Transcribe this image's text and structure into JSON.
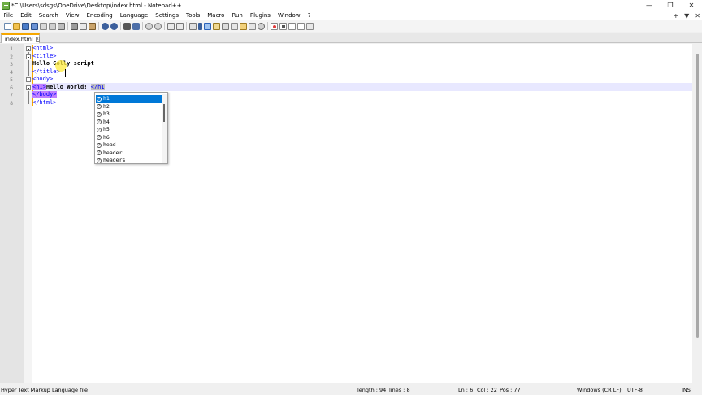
{
  "window": {
    "title": "*C:\\Users\\sdsgs\\OneDrive\\Desktop\\index.html - Notepad++",
    "minimize": "—",
    "maximize": "❐",
    "close": "✕"
  },
  "menu": {
    "items": [
      "File",
      "Edit",
      "Search",
      "View",
      "Encoding",
      "Language",
      "Settings",
      "Tools",
      "Macro",
      "Run",
      "Plugins",
      "Window",
      "?"
    ],
    "right_controls": [
      "+",
      "▼",
      "✕"
    ]
  },
  "toolbar": {
    "icons": [
      "new-file-icon",
      "open-file-icon",
      "save-icon",
      "save-all-icon",
      "close-icon",
      "close-all-icon",
      "print-icon",
      "cut-icon",
      "copy-icon",
      "paste-icon",
      "undo-icon",
      "redo-icon",
      "find-icon",
      "replace-icon",
      "zoom-in-icon",
      "zoom-out-icon",
      "sync-vertical-icon",
      "sync-horizontal-icon",
      "word-wrap-icon",
      "show-all-chars-icon",
      "indent-guide-icon",
      "doc-map-icon",
      "function-list-icon",
      "folder-workspace-icon",
      "monitoring-icon",
      "record-macro-icon",
      "stop-record-icon",
      "play-macro-icon",
      "play-multiple-icon",
      "save-macro-icon"
    ],
    "colors": {
      "accent": "#f6a700",
      "record": "#e03a3a"
    }
  },
  "tabs": [
    {
      "label": "index.html",
      "close": "x",
      "modified": true
    }
  ],
  "editor": {
    "line_numbers": [
      "1",
      "2",
      "3",
      "4",
      "5",
      "6",
      "7",
      "8"
    ],
    "lines": {
      "l1": "<html>",
      "l2": "<title>",
      "l3": "Hello Golly script",
      "l4": "</title>",
      "l5": "<body>",
      "l6_open": "<h1>",
      "l6_text": "Hello World! ",
      "l6_close": "</h1",
      "l7": "</body>",
      "l8": "</html>"
    },
    "current_line": 6
  },
  "autocomplete": {
    "items": [
      "h1",
      "h2",
      "h3",
      "h4",
      "h5",
      "h6",
      "head",
      "header",
      "headers"
    ],
    "selected_index": 0,
    "item_icon": "?"
  },
  "statusbar": {
    "language": "Hyper Text Markup Language file",
    "length": "length : 94",
    "lines": "lines : 8",
    "ln": "Ln : 6",
    "col": "Col : 22",
    "pos": "Pos : 77",
    "eol": "Windows (CR LF)",
    "encoding": "UTF-8",
    "mode": "INS"
  }
}
